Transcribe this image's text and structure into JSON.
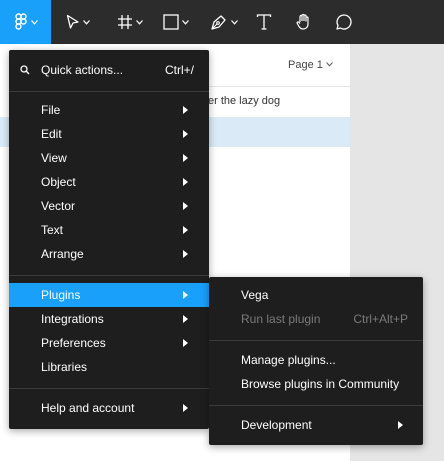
{
  "toolbar": {
    "tools": [
      {
        "name": "main-menu",
        "icon": "figma-logo-icon",
        "active": true
      },
      {
        "name": "move",
        "icon": "move-cursor-icon"
      },
      {
        "name": "frame",
        "icon": "frame-hash-icon"
      },
      {
        "name": "shape",
        "icon": "rectangle-icon"
      },
      {
        "name": "pen",
        "icon": "pen-icon"
      },
      {
        "name": "text",
        "icon": "text-icon"
      },
      {
        "name": "hand",
        "icon": "hand-icon"
      },
      {
        "name": "comment",
        "icon": "comment-icon"
      }
    ],
    "accent": "#18a0fb",
    "background": "#2c2c2c"
  },
  "panel": {
    "page_label": "Page 1",
    "layer_text": "er the lazy dog"
  },
  "main_menu": {
    "search": {
      "label": "Quick actions...",
      "shortcut": "Ctrl+/"
    },
    "items_group1": [
      {
        "label": "File"
      },
      {
        "label": "Edit"
      },
      {
        "label": "View"
      },
      {
        "label": "Object"
      },
      {
        "label": "Vector"
      },
      {
        "label": "Text"
      },
      {
        "label": "Arrange"
      }
    ],
    "items_group2": [
      {
        "label": "Plugins",
        "highlighted": true
      },
      {
        "label": "Integrations"
      },
      {
        "label": "Preferences"
      },
      {
        "label": "Libraries"
      }
    ],
    "help": {
      "label": "Help and account"
    }
  },
  "plugins_submenu": {
    "vega": "Vega",
    "run_last": {
      "label": "Run last plugin",
      "shortcut": "Ctrl+Alt+P"
    },
    "manage": "Manage plugins...",
    "browse": "Browse plugins in Community",
    "development": "Development"
  }
}
